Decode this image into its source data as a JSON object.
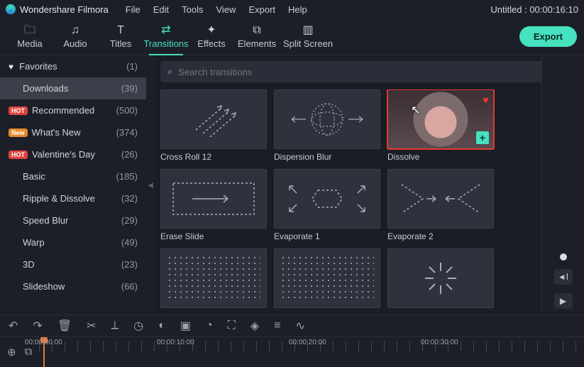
{
  "app": {
    "name": "Wondershare Filmora",
    "menu": [
      "File",
      "Edit",
      "Tools",
      "View",
      "Export",
      "Help"
    ],
    "doc_title": "Untitled",
    "timecode": "00:00:16:10"
  },
  "nav": {
    "items": [
      {
        "label": "Media",
        "icon": "🗀"
      },
      {
        "label": "Audio",
        "icon": "♫"
      },
      {
        "label": "Titles",
        "icon": "T"
      },
      {
        "label": "Transitions",
        "icon": "⇄"
      },
      {
        "label": "Effects",
        "icon": "✦"
      },
      {
        "label": "Elements",
        "icon": "⧉"
      },
      {
        "label": "Split Screen",
        "icon": "▥"
      }
    ],
    "active_index": 3,
    "export_label": "Export"
  },
  "sidebar": {
    "items": [
      {
        "label": "Favorites",
        "count": "(1)",
        "lead_heart": true
      },
      {
        "label": "Downloads",
        "count": "(39)",
        "selected": true
      },
      {
        "label": "Recommended",
        "count": "(500)",
        "badge": "HOT",
        "badge_color": "red"
      },
      {
        "label": "What's New",
        "count": "(374)",
        "badge": "New",
        "badge_color": "orange"
      },
      {
        "label": "Valentine's Day",
        "count": "(26)",
        "badge": "HOT",
        "badge_color": "red"
      },
      {
        "label": "Basic",
        "count": "(185)"
      },
      {
        "label": "Ripple & Dissolve",
        "count": "(32)"
      },
      {
        "label": "Speed Blur",
        "count": "(29)"
      },
      {
        "label": "Warp",
        "count": "(49)"
      },
      {
        "label": "3D",
        "count": "(23)"
      },
      {
        "label": "Slideshow",
        "count": "(66)"
      }
    ]
  },
  "search": {
    "placeholder": "Search transitions"
  },
  "grid": {
    "items": [
      {
        "label": "Cross Roll 12",
        "kind": "crossroll"
      },
      {
        "label": "Dispersion Blur",
        "kind": "dispersion"
      },
      {
        "label": "Dissolve",
        "kind": "dissolve",
        "selected": true,
        "favorited": true
      },
      {
        "label": "Erase Slide",
        "kind": "erase"
      },
      {
        "label": "Evaporate 1",
        "kind": "evap1"
      },
      {
        "label": "Evaporate 2",
        "kind": "evap2"
      },
      {
        "label": "",
        "kind": "dots"
      },
      {
        "label": "",
        "kind": "dots"
      },
      {
        "label": "",
        "kind": "spark"
      }
    ]
  },
  "timeline": {
    "marks": [
      "00:00:00:00",
      "00:00:10:00",
      "00:00:20:00",
      "00:00:30:00"
    ]
  }
}
